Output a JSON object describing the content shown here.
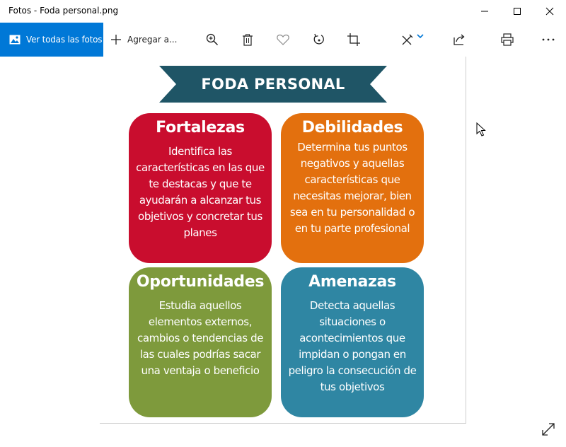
{
  "window": {
    "title": "Fotos - Foda personal.png"
  },
  "toolbar": {
    "see_all_label": "Ver todas las fotos",
    "add_label": "Agregar a...",
    "icons": [
      "zoom-in-icon",
      "delete-icon",
      "favorite-heart-icon",
      "rotate-icon",
      "crop-icon",
      "edit-create-icon",
      "chevron-down-icon",
      "share-icon",
      "print-icon",
      "more-options-icon"
    ]
  },
  "image": {
    "banner_title": "FODA PERSONAL",
    "cards": [
      {
        "title": "Fortalezas",
        "text": "Identifica las características en las que te destacas y que te ayudarán a alcanzar tus objetivos y concretar tus planes",
        "color": "#c90d2e"
      },
      {
        "title": "Debilidades",
        "text": "Determina tus puntos negativos y aquellas características que necesitas mejorar, bien sea en tu personalidad o en tu parte profesional",
        "color": "#e3700e"
      },
      {
        "title": "Oportunidades",
        "text": "Estudia aquellos elementos externos, cambios o tendencias de las cuales podrías sacar una ventaja o beneficio",
        "color": "#7e9a3c"
      },
      {
        "title": "Amenazas",
        "text": "Detecta aquellas situaciones o acontecimientos que impidan o pongan en peligro la consecución de tus objetivos",
        "color": "#2f86a3"
      }
    ],
    "banner_color": "#1f5566"
  },
  "colors": {
    "accent": "#0078d7"
  }
}
